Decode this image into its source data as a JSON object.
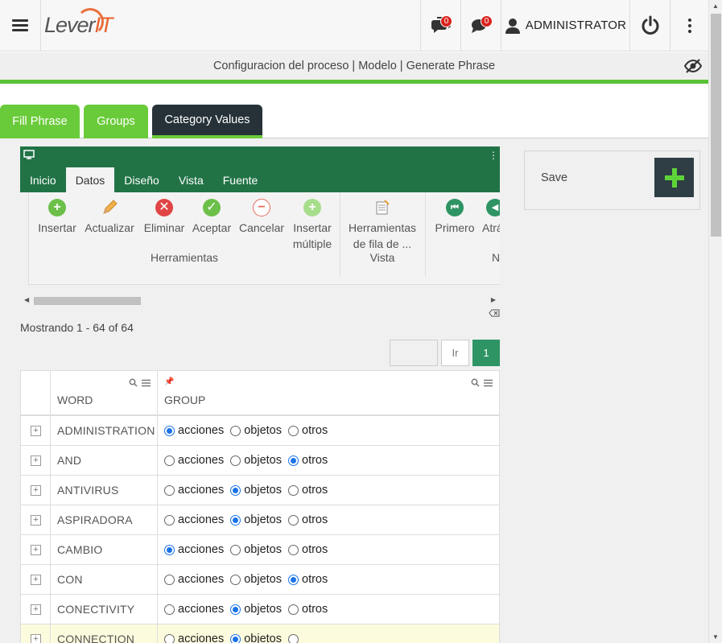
{
  "header": {
    "logo_text": "Lever",
    "logo_accent": "IT",
    "notifications": [
      {
        "icon": "chat-bubbles-icon",
        "count": "0"
      },
      {
        "icon": "chat-bubbles-icon",
        "count": "0"
      }
    ],
    "user_label": "ADMINISTRATOR"
  },
  "breadcrumb": "Configuracion del proceso | Modelo | Generate Phrase",
  "tabs": [
    {
      "label": "Fill Phrase"
    },
    {
      "label": "Groups"
    },
    {
      "label": "Category Values"
    }
  ],
  "ribbon": {
    "tabs": [
      "Inicio",
      "Datos",
      "Diseño",
      "Vista",
      "Fuente"
    ],
    "active_tab": "Datos",
    "buttons": [
      {
        "line1": "Insertar",
        "line2": ""
      },
      {
        "line1": "Actualizar",
        "line2": ""
      },
      {
        "line1": "Eliminar",
        "line2": ""
      },
      {
        "line1": "Aceptar",
        "line2": ""
      },
      {
        "line1": "Cancelar",
        "line2": ""
      },
      {
        "line1": "Insertar",
        "line2": "múltiple"
      },
      {
        "line1": "Herramientas",
        "line2": "de fila de ..."
      },
      {
        "line1": "Primero",
        "line2": ""
      },
      {
        "line1": "Atrá",
        "line2": ""
      }
    ],
    "groups": [
      "Herramientas",
      "Vista",
      "N"
    ]
  },
  "showing": "Mostrando 1 - 64 of 64",
  "pager": {
    "go_label": "Ir",
    "page": "1"
  },
  "grid": {
    "columns": [
      "WORD",
      "GROUP"
    ],
    "options": [
      "acciones",
      "objetos",
      "otros"
    ],
    "rows": [
      {
        "word": "ADMINISTRATION",
        "selected": "acciones"
      },
      {
        "word": "AND",
        "selected": "otros"
      },
      {
        "word": "ANTIVIRUS",
        "selected": "objetos"
      },
      {
        "word": "ASPIRADORA",
        "selected": "objetos"
      },
      {
        "word": "CAMBIO",
        "selected": "acciones"
      },
      {
        "word": "CON",
        "selected": "otros"
      },
      {
        "word": "CONECTIVITY",
        "selected": "objetos"
      },
      {
        "word": "CONNECTION",
        "selected": "objetos"
      }
    ]
  },
  "save_panel": {
    "label": "Save"
  },
  "colors": {
    "green": "#6acb3a",
    "dark": "#263238",
    "ribbon_green": "#217346",
    "badge_red": "#d9221c"
  }
}
